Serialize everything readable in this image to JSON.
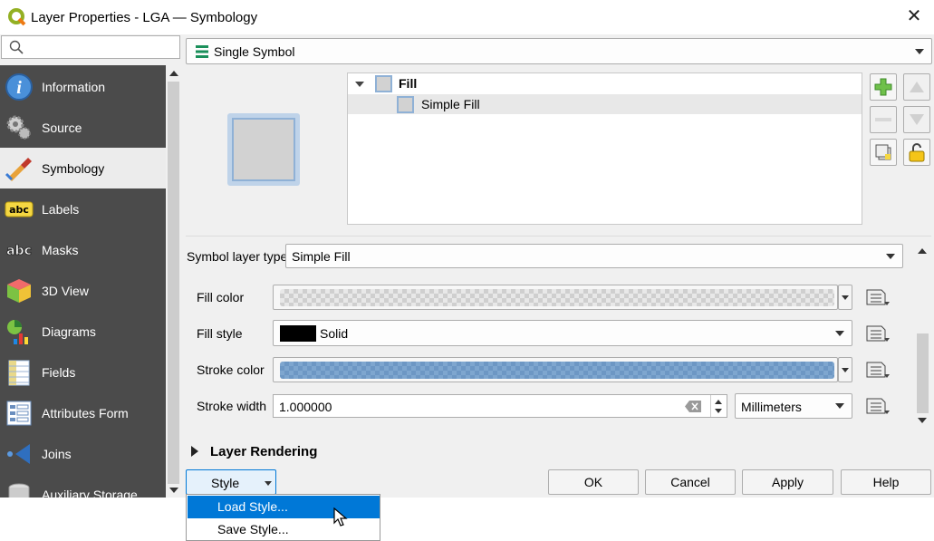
{
  "window": {
    "title": "Layer Properties - LGA — Symbology"
  },
  "search": {
    "placeholder": ""
  },
  "sidebar": {
    "items": [
      {
        "label": "Information",
        "icon": "info-icon"
      },
      {
        "label": "Source",
        "icon": "source-icon"
      },
      {
        "label": "Symbology",
        "icon": "symbology-icon",
        "selected": true
      },
      {
        "label": "Labels",
        "icon": "labels-icon"
      },
      {
        "label": "Masks",
        "icon": "masks-icon"
      },
      {
        "label": "3D View",
        "icon": "3d-view-icon"
      },
      {
        "label": "Diagrams",
        "icon": "diagrams-icon"
      },
      {
        "label": "Fields",
        "icon": "fields-icon"
      },
      {
        "label": "Attributes Form",
        "icon": "attributes-form-icon"
      },
      {
        "label": "Joins",
        "icon": "joins-icon"
      },
      {
        "label": "Auxiliary Storage",
        "icon": "auxiliary-storage-icon"
      }
    ]
  },
  "renderer": {
    "selected": "Single Symbol"
  },
  "symbol_tree": {
    "root": "Fill",
    "child": "Simple Fill"
  },
  "symbol_layer": {
    "type_label": "Symbol layer type",
    "type_value": "Simple Fill",
    "fill_color_label": "Fill color",
    "fill_style_label": "Fill style",
    "fill_style_value": "Solid",
    "stroke_color_label": "Stroke color",
    "stroke_width_label": "Stroke width",
    "stroke_width_value": "1.000000",
    "units_value": "Millimeters"
  },
  "layer_rendering": {
    "label": "Layer Rendering"
  },
  "buttons": {
    "style": "Style",
    "ok": "OK",
    "cancel": "Cancel",
    "apply": "Apply",
    "help": "Help"
  },
  "style_menu": {
    "items": [
      "Load Style...",
      "Save Style..."
    ],
    "highlighted": 0
  },
  "colors": {
    "sidebar_bg": "#4b4b4b",
    "highlight": "#0078d7",
    "stroke_color": "#7ea6cf"
  }
}
